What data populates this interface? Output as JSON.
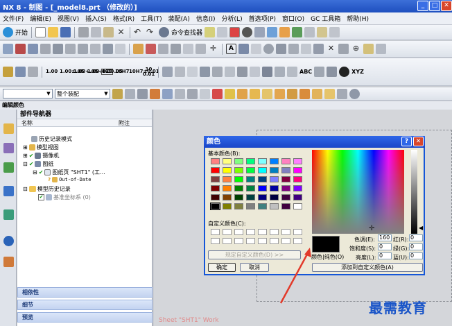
{
  "window": {
    "title": "NX 8 - 制图 - [_model8.prt （修改的）]"
  },
  "menu": [
    "文件(F)",
    "编辑(E)",
    "视图(V)",
    "插入(S)",
    "格式(R)",
    "工具(T)",
    "装配(A)",
    "信息(I)",
    "分析(L)",
    "首选项(P)",
    "窗口(O)",
    "GC 工具箱",
    "帮助(H)"
  ],
  "toolbar": {
    "start_label": "开始",
    "command_finder_label": "命令查找器",
    "dims": [
      "1.00",
      "1.00±.05",
      "1.00+.05-.02",
      "1.00+.05-.05",
      "1.00",
      "10H7",
      "10H7±0.01",
      "10 0.01"
    ]
  },
  "toolbar_text": [
    "ABC",
    "XYZ"
  ],
  "selection": {
    "filter_placeholder": "",
    "assembly_scope": "整个装配"
  },
  "edit_color_bar": "编辑颜色",
  "navigator": {
    "title": "部件导航器",
    "columns": [
      "名称",
      "附注"
    ],
    "tree": [
      {
        "label": "历史记录模式",
        "level": 0
      },
      {
        "label": "模型视图",
        "level": 0
      },
      {
        "label": "摄像机",
        "level": 0
      },
      {
        "label": "图纸",
        "level": 0
      },
      {
        "label": "图纸页 \"SHT1\" (工...",
        "level": 1
      },
      {
        "label": "Out-of-Date",
        "level": 2
      },
      {
        "label": "模型历史记录",
        "level": 0
      },
      {
        "label": "基准坐标系 (0)",
        "level": 1
      }
    ],
    "panels": [
      "相依性",
      "细节",
      "预览"
    ]
  },
  "sheet_label": "Sheet \"SHT1\" Work",
  "dialog": {
    "title": "颜色",
    "basic_colors_label": "基本颜色(B):",
    "custom_colors_label": "自定义颜色(C):",
    "define_custom_button": "规定自定义颜色(D) >>",
    "ok_button": "确定",
    "cancel_button": "取消",
    "color_solid_label": "颜色|纯色(O)",
    "hue_label": "色调(E):",
    "hue": "160",
    "sat_label": "饱和度(S):",
    "sat": "0",
    "lum_label": "亮度(L):",
    "lum": "0",
    "red_label": "红(R):",
    "red": "0",
    "green_label": "绿(G):",
    "green": "0",
    "blue_label": "蓝(U):",
    "blue": "0",
    "add_custom_button": "添加到自定义颜色(A)",
    "selected_color": "#000000",
    "basic_colors": [
      "#ff8080",
      "#ffff80",
      "#80ff80",
      "#00ff80",
      "#80ffff",
      "#0080ff",
      "#ff80c0",
      "#ff80ff",
      "#ff0000",
      "#ffff00",
      "#80ff00",
      "#00ff40",
      "#00ffff",
      "#0080c0",
      "#8080c0",
      "#ff00ff",
      "#804040",
      "#ff8040",
      "#00ff00",
      "#008080",
      "#004080",
      "#8080ff",
      "#800040",
      "#ff0080",
      "#800000",
      "#ff8000",
      "#008000",
      "#008040",
      "#0000ff",
      "#0000a0",
      "#800080",
      "#8000ff",
      "#400000",
      "#804000",
      "#004000",
      "#004040",
      "#000080",
      "#000040",
      "#400040",
      "#400080",
      "#000000",
      "#808000",
      "#808040",
      "#808080",
      "#408080",
      "#c0c0c0",
      "#400040",
      "#ffffff"
    ]
  },
  "watermark": "最需教育"
}
